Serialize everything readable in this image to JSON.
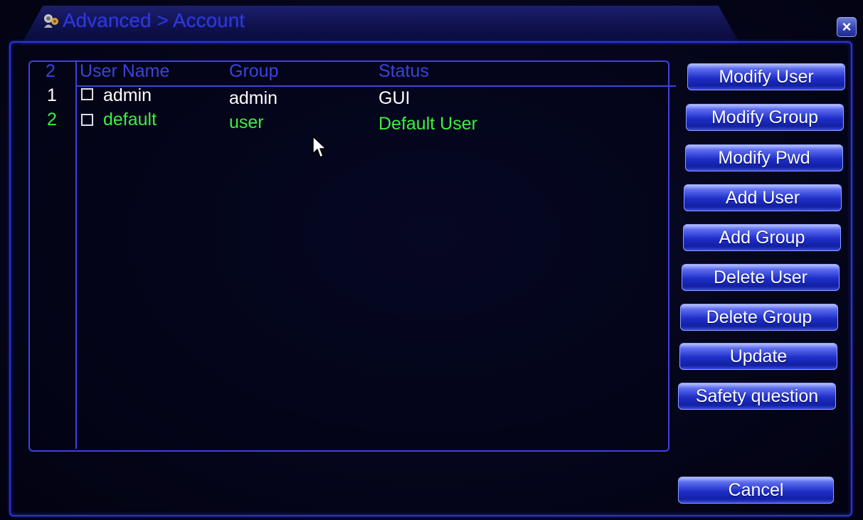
{
  "window": {
    "title": "Advanced > Account",
    "title_icon": "account-icon",
    "close_label": "×"
  },
  "table": {
    "count": "2",
    "headers": {
      "user_name": "User Name",
      "group": "Group",
      "status": "Status"
    },
    "rows": [
      {
        "index": "1",
        "user_name": "admin",
        "group": "admin",
        "status": "GUI",
        "checked": false,
        "color": "#ffffff"
      },
      {
        "index": "2",
        "user_name": "default",
        "group": "user",
        "status": "Default User",
        "checked": false,
        "color": "#3cf040"
      }
    ]
  },
  "buttons": {
    "modify_user": "Modify User",
    "modify_group": "Modify Group",
    "modify_pwd": "Modify Pwd",
    "add_user": "Add User",
    "add_group": "Add Group",
    "delete_user": "Delete User",
    "delete_group": "Delete Group",
    "update": "Update",
    "safety_question": "Safety question",
    "cancel": "Cancel"
  },
  "colors": {
    "accent_blue": "#3a44e0",
    "selected_row_green": "#3cf040",
    "text_white": "#ffffff"
  }
}
